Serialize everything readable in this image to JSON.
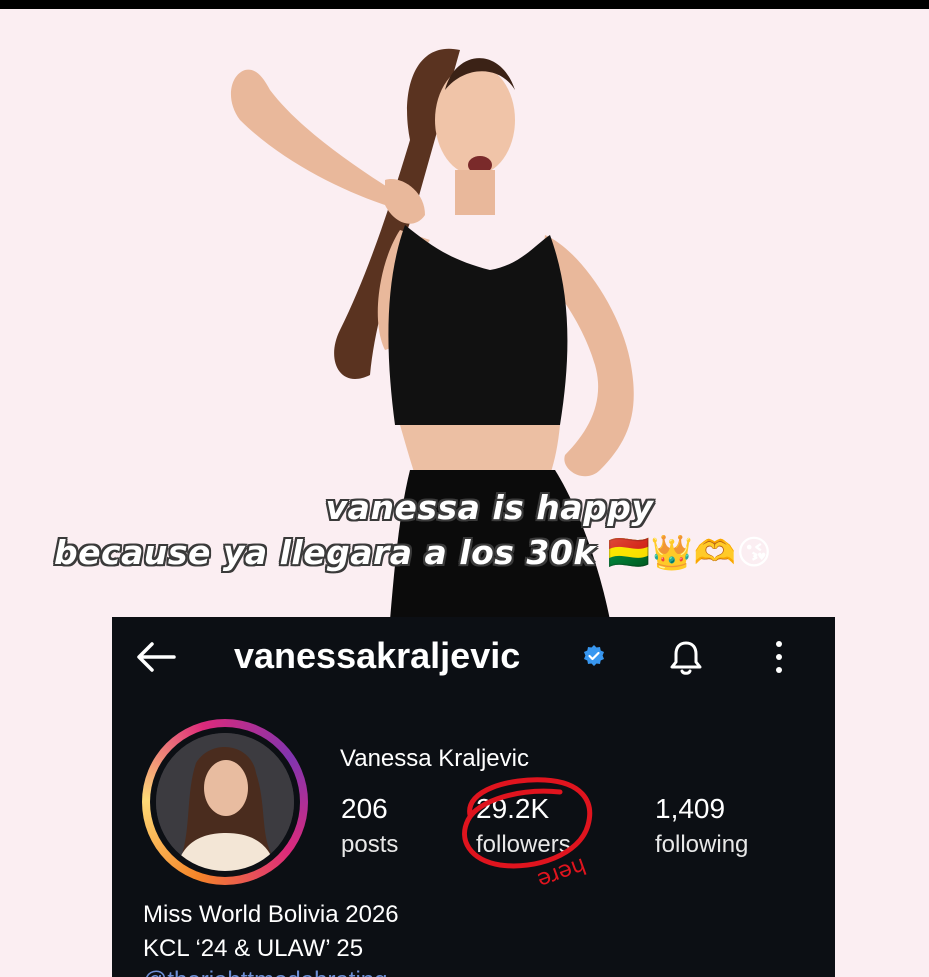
{
  "caption": {
    "line1": "vanessa is happy",
    "line2": "because ya llegara a los 30k",
    "emojis": "🇧🇴👑🫶😘"
  },
  "profile": {
    "username": "vanessakraljevic",
    "full_name": "Vanessa Kraljevic",
    "stats": [
      {
        "value": "206",
        "label": "posts"
      },
      {
        "value": "29.2K",
        "label": "followers"
      },
      {
        "value": "1,409",
        "label": "following"
      }
    ],
    "bio": [
      "Miss World Bolivia 2026",
      "KCL ‘24 & ULAW’ 25"
    ],
    "bio_link": "@theriahttmedabrating"
  },
  "annotation": {
    "text": "here"
  },
  "icons": {
    "back": "back-arrow-icon",
    "verified": "verified-badge-icon",
    "bell": "bell-icon",
    "more": "more-vertical-icon"
  },
  "colors": {
    "background": "#fbeef2",
    "card": "#0c0f14",
    "verified": "#3897f0",
    "marker": "#e0141e"
  }
}
